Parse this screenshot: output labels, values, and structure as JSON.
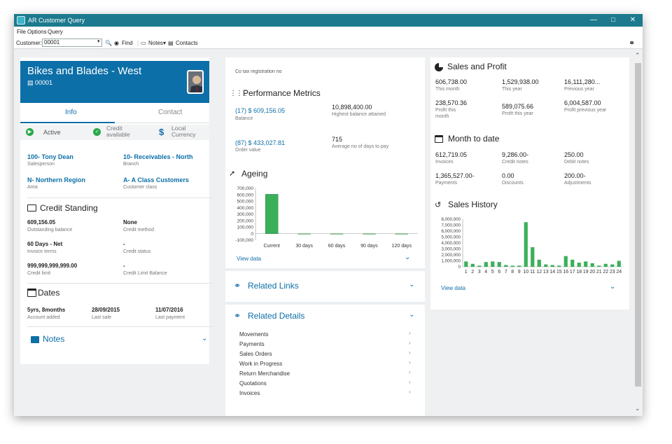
{
  "window": {
    "title": "AR Customer Query"
  },
  "menu": [
    "File",
    "Options",
    "Query"
  ],
  "toolbar": {
    "customer_label": "Customer:",
    "customer_value": "00001",
    "find_label": "Find",
    "notes_label": "Notes",
    "contacts_label": "Contacts"
  },
  "customer": {
    "name": "Bikes and Blades - West",
    "account": "00001"
  },
  "tabs": [
    "Info",
    "Contact"
  ],
  "status": {
    "active": "Active",
    "credit": "Credit available",
    "currency": "Local Currency"
  },
  "info": {
    "salesperson_value": "100- Tony Dean",
    "salesperson_label": "Salesperson",
    "branch_value": "10- Receivables - North",
    "branch_label": "Branch",
    "area_value": "N- Northern Region",
    "area_label": "Area",
    "class_value": "A- A Class Customers",
    "class_label": "Customer class"
  },
  "credit_standing": {
    "title": "Credit Standing",
    "outstanding_value": "609,156.05",
    "outstanding_label": "Outstanding balance",
    "method_value": "None",
    "method_label": "Credit method",
    "terms_value": "60 Days - Net",
    "terms_label": "Invoice terms",
    "status_value": "-",
    "status_label": "Credit status",
    "limit_value": "999,999,999,999.00",
    "limit_label": "Credit limit",
    "limit_balance_value": "-",
    "limit_balance_label": "Credit Limit Balance"
  },
  "dates": {
    "title": "Dates",
    "added_value": "5yrs, 8months",
    "added_label": "Account added",
    "last_sale_value": "28/09/2015",
    "last_sale_label": "Last sale",
    "last_payment_value": "11/07/2016",
    "last_payment_label": "Last payment"
  },
  "notes": {
    "title": "Notes"
  },
  "performance": {
    "tax_label": "Co tax registration no",
    "title": "Performance Metrics",
    "balance_value": "(17) $ 609,156.05",
    "balance_label": "Balance",
    "highest_value": "10,898,400.00",
    "highest_label": "Highest balance attained",
    "order_value": "(87) $ 433,027.81",
    "order_label": "Order value",
    "days_value": "715",
    "days_label": "Average no of days to pay"
  },
  "ageing": {
    "title": "Ageing",
    "view_data": "View data"
  },
  "related_links": {
    "title": "Related Links"
  },
  "related_details": {
    "title": "Related Details",
    "items": [
      "Movements",
      "Payments",
      "Sales Orders",
      "Work in Progress",
      "Return Merchandise",
      "Quotations",
      "Invoices"
    ]
  },
  "sales_profit": {
    "title": "Sales and Profit",
    "this_month_value": "606,738.00",
    "this_month_label": "This month",
    "this_year_value": "1,529,938.00",
    "this_year_label": "This year",
    "prev_year_value": "16,111,280...",
    "prev_year_label": "Previous year",
    "profit_month_value": "238,570.36",
    "profit_month_label": "Profit this month",
    "profit_year_value": "589,075.66",
    "profit_year_label": "Profit this year",
    "profit_prev_value": "6,004,587.00",
    "profit_prev_label": "Profit previous year"
  },
  "month_to_date": {
    "title": "Month to date",
    "invoices_value": "612,719.05",
    "invoices_label": "Invoices",
    "credit_notes_value": "9,286.00-",
    "credit_notes_label": "Credit notes",
    "debit_notes_value": "250.00",
    "debit_notes_label": "Debit notes",
    "payments_value": "1,365,527.00-",
    "payments_label": "Payments",
    "discounts_value": "0.00",
    "discounts_label": "Discounts",
    "adjustments_value": "200.00-",
    "adjustments_label": "Adjustments"
  },
  "sales_history": {
    "title": "Sales History",
    "view_data": "View data"
  },
  "colors": {
    "accent": "#0d6fa8",
    "titlebar": "#1d7a8e",
    "bar": "#3caf5a",
    "active": "#2aa84a"
  },
  "chart_data": [
    {
      "type": "bar",
      "name": "ageing",
      "categories": [
        "Current",
        "30 days",
        "60 days",
        "90 days",
        "120 days"
      ],
      "values": [
        609156,
        0,
        0,
        0,
        0
      ],
      "yticks": [
        "700,000",
        "600,000",
        "500,000",
        "400,000",
        "300,000",
        "200,000",
        "100,000",
        "0",
        "-100,000"
      ],
      "ylim": [
        -100000,
        700000
      ]
    },
    {
      "type": "bar",
      "name": "sales_history",
      "categories": [
        "1",
        "2",
        "3",
        "4",
        "5",
        "6",
        "7",
        "8",
        "9",
        "10",
        "11",
        "12",
        "13",
        "14",
        "15",
        "16",
        "17",
        "18",
        "19",
        "20",
        "21",
        "22",
        "23",
        "24"
      ],
      "values": [
        900000,
        500000,
        200000,
        800000,
        900000,
        800000,
        300000,
        200000,
        200000,
        7500000,
        3300000,
        1200000,
        400000,
        300000,
        200000,
        1800000,
        1200000,
        700000,
        900000,
        600000,
        200000,
        500000,
        400000,
        1000000
      ],
      "yticks": [
        "8,000,000",
        "7,000,000",
        "6,000,000",
        "5,000,000",
        "4,000,000",
        "3,000,000",
        "2,000,000",
        "1,000,000",
        "0"
      ],
      "ylim": [
        0,
        8000000
      ]
    }
  ]
}
